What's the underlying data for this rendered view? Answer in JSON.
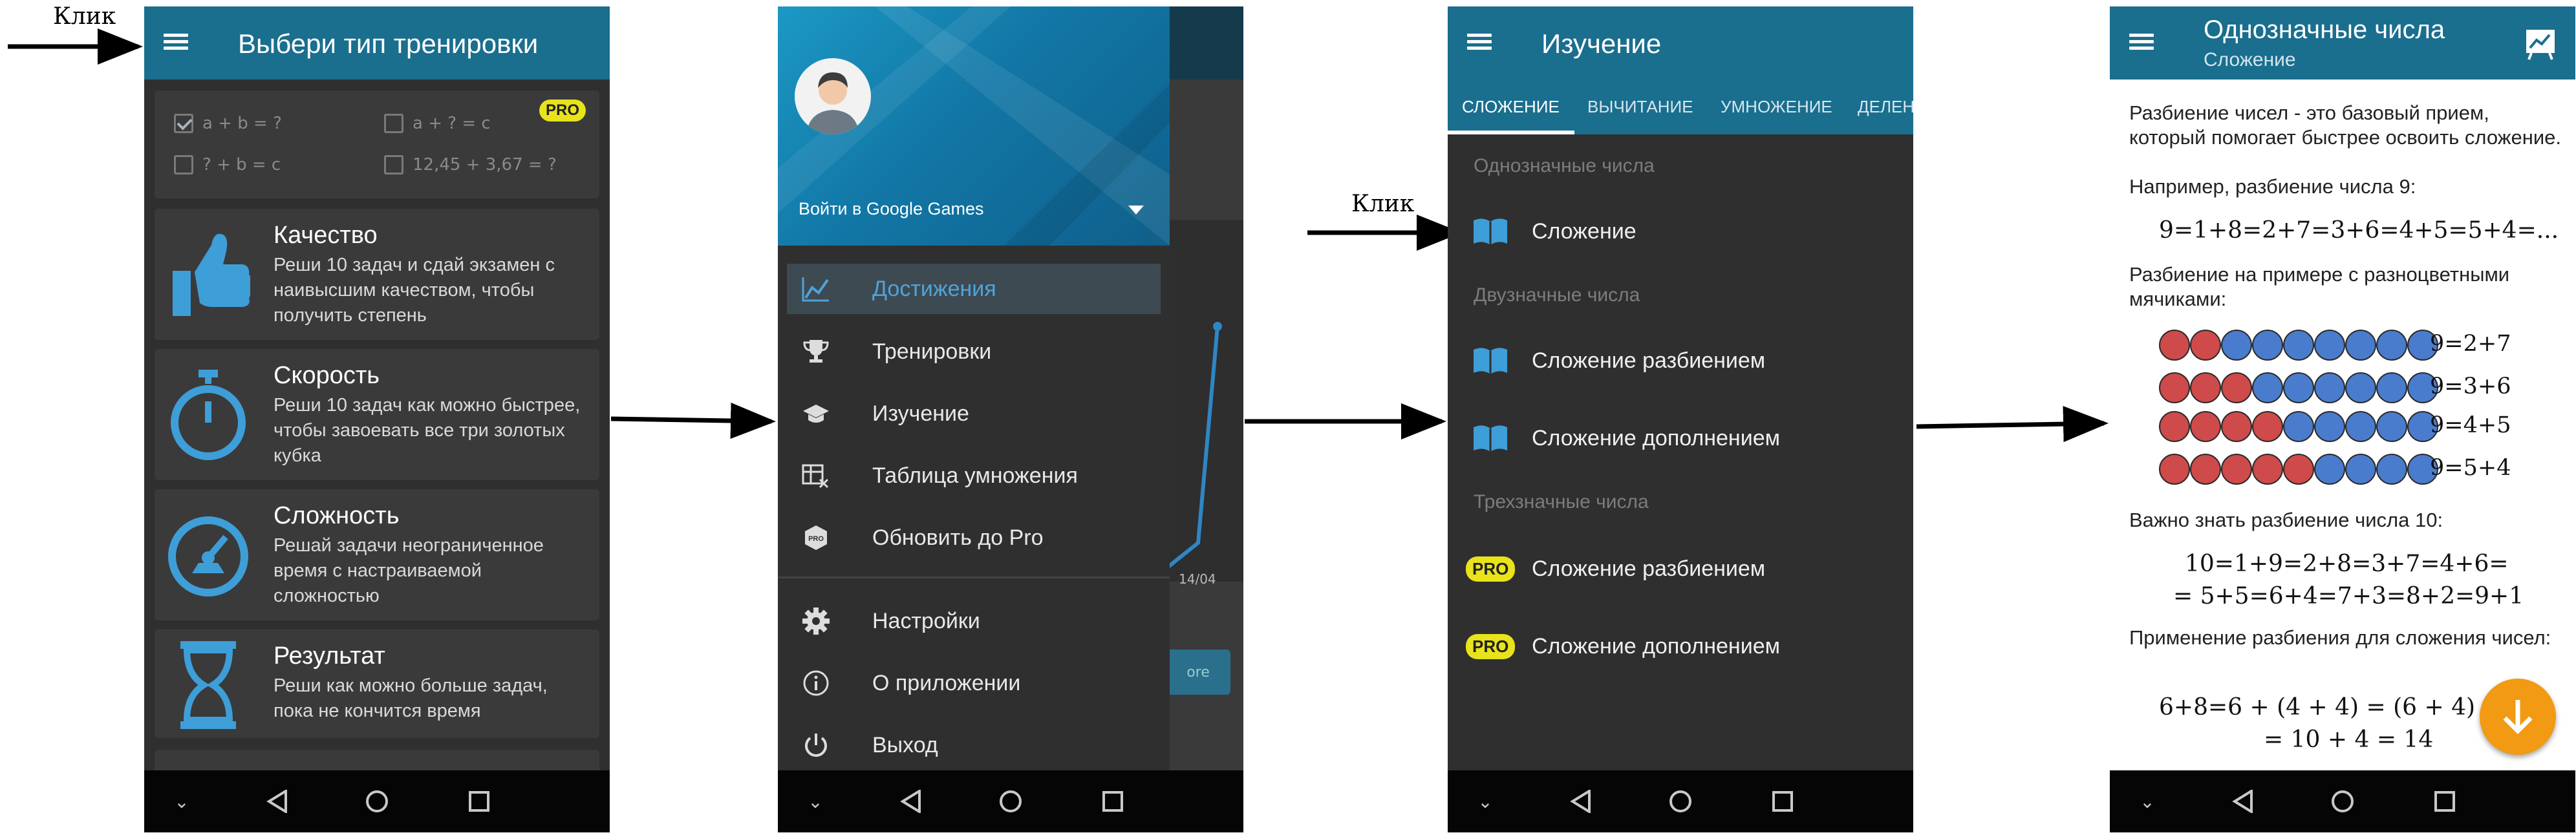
{
  "annotations": {
    "click_label": "Клик"
  },
  "screen1": {
    "title": "Выбери тип тренировки",
    "options": [
      {
        "label": "a + b = ?",
        "checked": true
      },
      {
        "label": "a + ? = c",
        "checked": false
      },
      {
        "label": "? + b = c",
        "checked": false
      },
      {
        "label": "12,45 + 3,67 = ?",
        "checked": false
      }
    ],
    "pro_badge": "PRO",
    "cards": [
      {
        "title": "Качество",
        "desc": "Реши 10 задач и сдай экзамен с наивысшим качеством, чтобы получить степень",
        "icon": "thumbs-up-icon"
      },
      {
        "title": "Скорость",
        "desc": "Реши 10 задач как можно быстрее, чтобы завоевать все три золотых кубка",
        "icon": "stopwatch-icon"
      },
      {
        "title": "Сложность",
        "desc": "Решай задачи неограниченное время с настраиваемой сложностью",
        "icon": "gauge-icon"
      },
      {
        "title": "Результат",
        "desc": "Реши как можно больше задач, пока не кончится время",
        "icon": "hourglass-icon"
      }
    ]
  },
  "screen2": {
    "signin": "Войти в Google Games",
    "items": [
      {
        "label": "Достижения",
        "icon": "chart-icon",
        "active": true
      },
      {
        "label": "Тренировки",
        "icon": "trophy-icon",
        "active": false
      },
      {
        "label": "Изучение",
        "icon": "graduation-cap-icon",
        "active": false
      },
      {
        "label": "Таблица умножения",
        "icon": "table-icon",
        "active": false
      },
      {
        "label": "Обновить до Pro",
        "icon": "pro-icon",
        "active": false
      },
      {
        "label": "Настройки",
        "icon": "gear-icon",
        "active": false
      },
      {
        "label": "О приложении",
        "icon": "info-icon",
        "active": false
      },
      {
        "label": "Выход",
        "icon": "power-icon",
        "active": false
      }
    ],
    "behind": {
      "date": "14/04",
      "button": "ore"
    }
  },
  "screen3": {
    "title": "Изучение",
    "tabs": [
      "СЛОЖЕНИЕ",
      "ВЫЧИТАНИЕ",
      "УМНОЖЕНИЕ",
      "ДЕЛЕН"
    ],
    "sections": [
      {
        "header": "Однозначные числа",
        "items": [
          {
            "label": "Сложение",
            "pro": false
          }
        ]
      },
      {
        "header": "Двузначные числа",
        "items": [
          {
            "label": "Сложение разбиением",
            "pro": false
          },
          {
            "label": "Сложение дополнением",
            "pro": false
          }
        ]
      },
      {
        "header": "Трехзначные числа",
        "items": [
          {
            "label": "Сложение разбиением",
            "pro": true
          },
          {
            "label": "Сложение дополнением",
            "pro": true
          }
        ]
      }
    ],
    "pro_badge": "PRO"
  },
  "screen4": {
    "title": "Однозначные числа",
    "subtitle": "Сложение",
    "p1": "Разбиение чисел - это базовый прием, который помогает быстрее освоить сложение.",
    "p1b": "Например, разбиение числа 9:",
    "formula1": "9=1+8=2+7=3+6=4+5=5+4=...",
    "p2": "Разбиение на примере с разноцветными мячиками:",
    "balls": [
      {
        "red": 2,
        "blue": 7,
        "eq": "9=2+7"
      },
      {
        "red": 3,
        "blue": 6,
        "eq": "9=3+6"
      },
      {
        "red": 4,
        "blue": 5,
        "eq": "9=4+5"
      },
      {
        "red": 5,
        "blue": 4,
        "eq": "9=5+4"
      }
    ],
    "p3": "Важно знать разбиение числа 10:",
    "formula2a": "10=1+9=2+8=3+7=4+6=",
    "formula2b": "= 5+5=6+4=7+3=8+2=9+1",
    "p4": "Применение разбиения для сложения чисел:",
    "formula3a": "6+8=6 + (4 + 4) = (6 + 4) +",
    "formula3b": "= 10 + 4 = 14"
  }
}
